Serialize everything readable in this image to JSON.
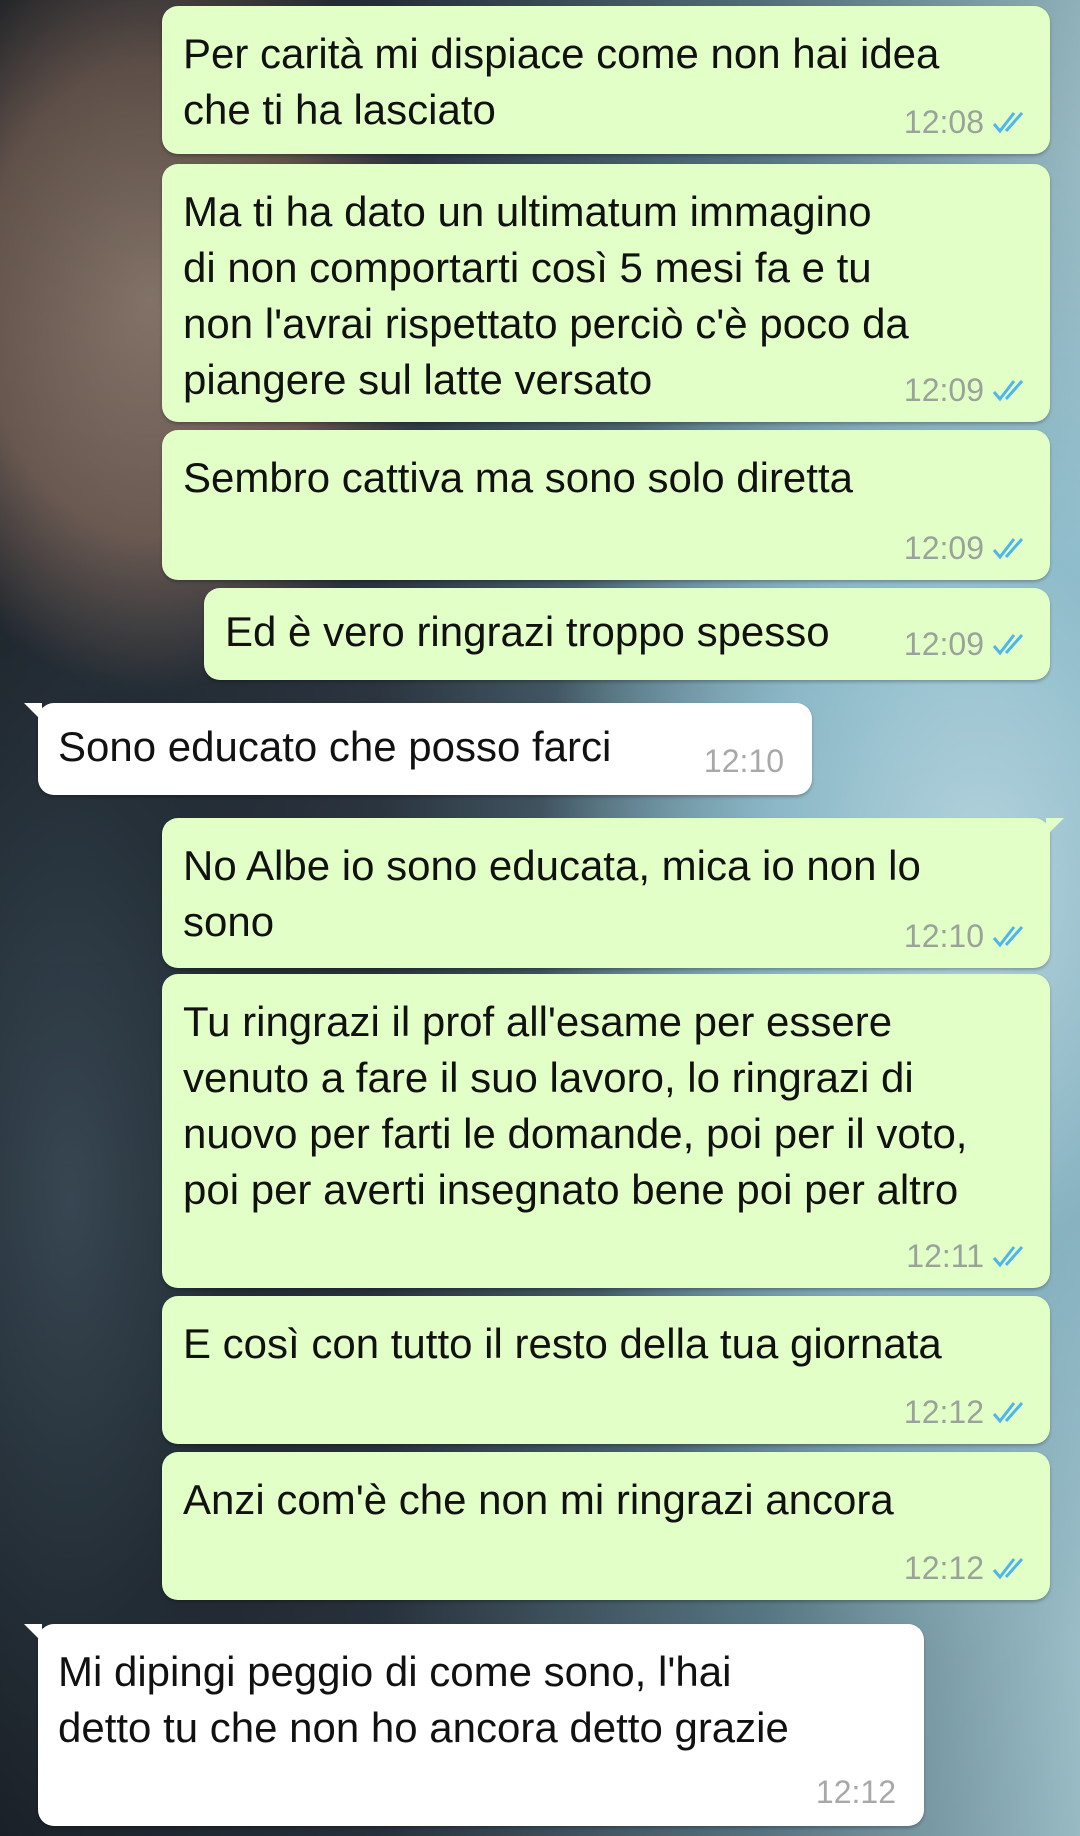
{
  "colors": {
    "outgoing_bubble": "#e2ffc8",
    "incoming_bubble": "#ffffff",
    "read_ticks": "#4fb6ec"
  },
  "messages": [
    {
      "direction": "out",
      "text": "Per carità mi dispiace come non hai idea\nche ti ha lasciato",
      "time": "12:08",
      "status": "read"
    },
    {
      "direction": "out",
      "text": "Ma ti ha dato un ultimatum immagino\ndi non comportarti così 5 mesi fa e tu\nnon l'avrai rispettato perciò c'è poco da\npiangere sul latte versato",
      "time": "12:09",
      "status": "read"
    },
    {
      "direction": "out",
      "text": "Sembro cattiva ma sono solo diretta",
      "time": "12:09",
      "status": "read"
    },
    {
      "direction": "out",
      "text": "Ed è vero ringrazi troppo spesso",
      "time": "12:09",
      "status": "read"
    },
    {
      "direction": "in",
      "text": "Sono educato che posso farci",
      "time": "12:10"
    },
    {
      "direction": "out",
      "text": "No Albe io sono educata, mica io non lo\nsono",
      "time": "12:10",
      "status": "read"
    },
    {
      "direction": "out",
      "text": "Tu ringrazi il prof all'esame per essere\nvenuto a fare il suo lavoro, lo ringrazi di\nnuovo per farti le domande, poi per il voto,\npoi per averti insegnato bene poi per altro",
      "time": "12:11",
      "status": "read"
    },
    {
      "direction": "out",
      "text": "E così con tutto il resto della tua giornata",
      "time": "12:12",
      "status": "read"
    },
    {
      "direction": "out",
      "text": "Anzi com'è che non mi ringrazi ancora",
      "time": "12:12",
      "status": "read"
    },
    {
      "direction": "in",
      "text": "Mi dipingi peggio di come sono, l'hai\ndetto tu che non ho ancora detto grazie",
      "time": "12:12"
    }
  ]
}
